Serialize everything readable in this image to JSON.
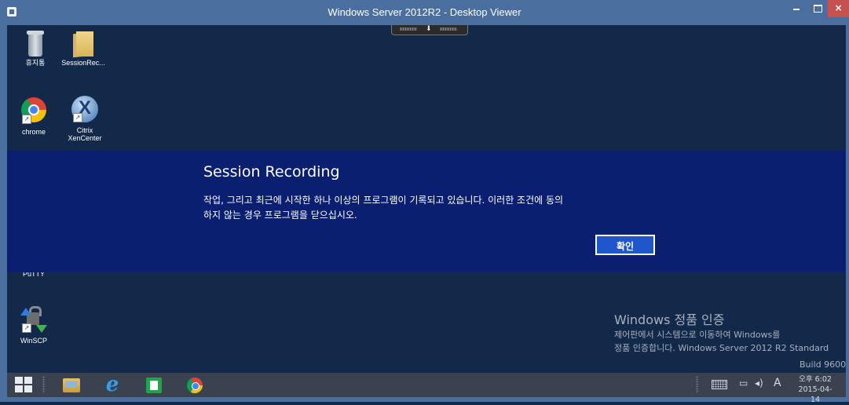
{
  "window": {
    "title": "Windows Server 2012R2 - Desktop Viewer",
    "close_label": "×"
  },
  "viewer_toolbar": {
    "arrow_glyph": "⬇"
  },
  "desktop_icons": {
    "recycle_bin": "휴지통",
    "session_rec": "SessionRec...",
    "chrome": "chrome",
    "citrix_line1": "Citrix",
    "citrix_line2": "XenCenter",
    "putty": "PuTTY",
    "winscp": "WinSCP"
  },
  "dialog": {
    "title": "Session Recording",
    "message_line1": "작업, 그리고 최근에 시작한 하나 이상의 프로그램이 기록되고 있습니다. 이러한 조건에 동의",
    "message_line2": "하지 않는 경우 프로그램을 닫으십시오.",
    "ok_label": "확인"
  },
  "watermark": {
    "title": "Windows 정품 인증",
    "line1": "제어판에서 시스템으로 이동하여 Windows를",
    "line2": "정품 인증합니다. Windows Server 2012 R2 Standard",
    "build": "Build 9600"
  },
  "taskbar": {
    "ie_glyph": "e",
    "ime_label": "A",
    "time": "오후 6:02",
    "date": "2015-04-14"
  },
  "colors": {
    "titlebar": "#4a6f9e",
    "desktop": "#12294a",
    "dialog_bg": "#0a1f70",
    "ok_button": "#1f56c9",
    "taskbar": "#3a4250",
    "close_button": "#c75050"
  }
}
